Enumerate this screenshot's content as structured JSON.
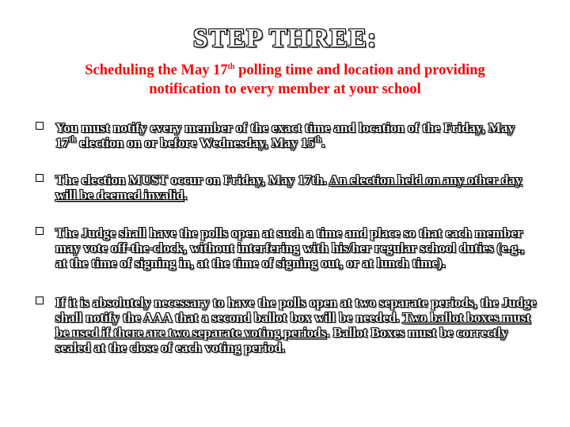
{
  "slide": {
    "title": "STEP THREE:",
    "subtitle": {
      "line1_a": "Scheduling the May 17",
      "line1_sup": "th",
      "line1_b": " polling time and location and providing",
      "line2": "notification to every member at your school"
    },
    "bullets": [
      {
        "p1": "You must notify every member of the exact time and location of the Friday, May 17",
        "sup1": "th",
        "p2": " election on or before Wednesday, May 15",
        "sup2": "th",
        "p3": "."
      },
      {
        "p1": "The election MUST occur on Friday, May 17th.  ",
        "u1": "An election held on any other day will be deemed invalid",
        "p2": "."
      },
      {
        "p1": "The Judge shall have the polls open at such a time and place so that each member may vote off-the-clock, without interfering with his/her regular school duties (e.g., at the time of signing in, at the time of signing out, or at lunch time)."
      },
      {
        "p1": "If it is absolutely necessary to have the polls open at two separate periods, the Judge shall notify the AAA that a second ballot box will be needed.  ",
        "u1": "Two ballot boxes must be used if there are two separate voting periods",
        "p2": ". Ballot Boxes must be correctly sealed at the close of each voting period."
      }
    ]
  },
  "colors": {
    "subtitle": "#ff0000",
    "text_fill": "#ffffff",
    "text_outline": "#000000",
    "background": "#ffffff"
  }
}
